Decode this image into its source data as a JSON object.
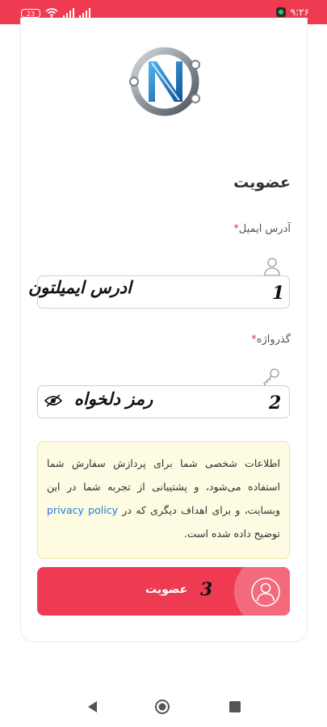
{
  "status_bar": {
    "battery": "23",
    "time": "۹:۲۶"
  },
  "form": {
    "title": "عضویت",
    "email_label": "آدرس ایمیل",
    "required_mark": "*",
    "email_value": "ادرس ایمیلتون",
    "email_step": "1",
    "password_label": "گذرواژه",
    "password_value": "رمز دلخواه",
    "password_step": "2",
    "notice_text": "اطلاعات شخصی شما برای پردازش سفارش شما استفاده می‌شود، و پشتیبانی از تجربه شما در این وبسایت، و برای اهداف دیگری که در",
    "notice_link": "privacy policy",
    "notice_tail": "توضیح داده شده است.",
    "submit_label": "عضویت",
    "submit_step": "3"
  },
  "icons": {
    "user": "user-icon",
    "key": "key-icon",
    "eye": "eye-slash-icon"
  },
  "colors": {
    "accent": "#ee3b52",
    "notice_bg": "#fdfbe1",
    "link": "#1f7ad6"
  }
}
